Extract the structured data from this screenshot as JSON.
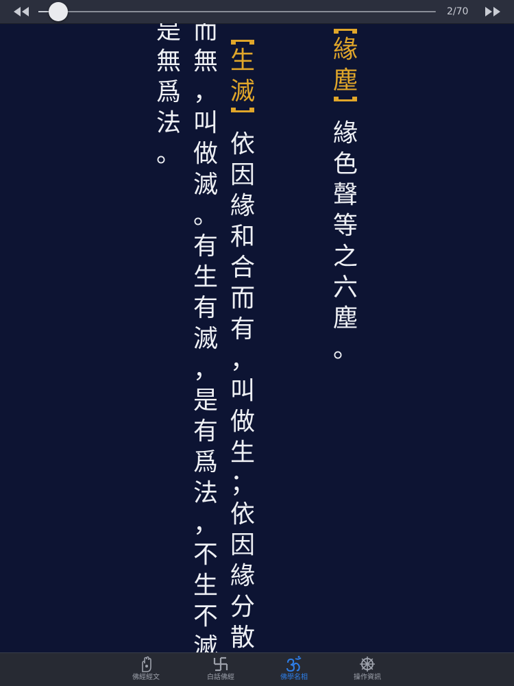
{
  "slider": {
    "page_text": "2/70",
    "progress": 0.05
  },
  "content": {
    "columns": [
      {
        "heading": "緣塵",
        "body": "緣色聲等之六塵。"
      },
      {
        "heading": "生滅",
        "body": "依因緣和合而有，叫做生；依因緣分散"
      },
      {
        "heading": "",
        "body": "而無，叫做滅。有生有滅，是有爲法，不生不滅，"
      },
      {
        "heading": "",
        "body": "是無爲法。"
      }
    ]
  },
  "tabbar": {
    "tabs": [
      {
        "label": "佛經經文",
        "icon": "hand-icon"
      },
      {
        "label": "白話佛經",
        "icon": "swastika-icon"
      },
      {
        "label": "佛學名相",
        "icon": "om-icon"
      },
      {
        "label": "操作資訊",
        "icon": "dharma-wheel-icon"
      }
    ],
    "active_index": 2
  },
  "colors": {
    "background": "#0d1433",
    "heading": "#e0a62a",
    "text": "#eef0f4",
    "active_tab": "#2e7ee8",
    "inactive_tab": "#9da1ab"
  }
}
